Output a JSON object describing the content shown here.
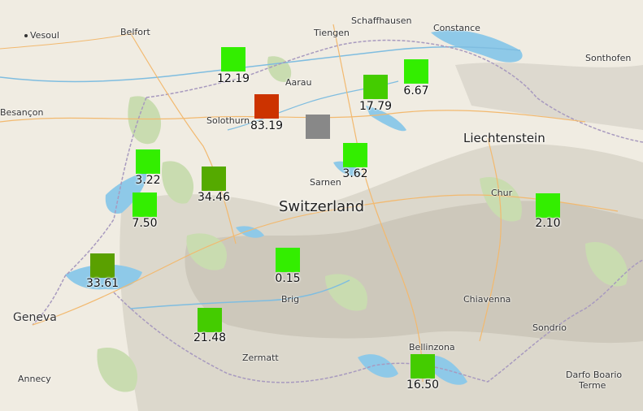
{
  "countries": {
    "switzerland": "Switzerland",
    "liechtenstein": "Liechtenstein"
  },
  "places": {
    "vesoul": "Vesoul",
    "belfort": "Belfort",
    "besancon": "Besançon",
    "tiengen": "Tiengen",
    "schaffhausen": "Schaffhausen",
    "constance": "Constance",
    "sonthofen": "Sonthofen",
    "aarau": "Aarau",
    "solothurn": "Solothurn",
    "sarnen": "Sarnen",
    "chur": "Chur",
    "geneva": "Geneva",
    "annecy": "Annecy",
    "brig": "Brig",
    "zermatt": "Zermatt",
    "chiavenna": "Chiavenna",
    "bellinzona": "Bellinzona",
    "sondrio": "Sondrio",
    "darfo_1": "Darfo Boario",
    "darfo_2": "Terme"
  },
  "colors": {
    "bright_green": "#33ee00",
    "green": "#44cc00",
    "dark_green": "#55aa00",
    "olive_green": "#5aa000",
    "red": "#cc3300",
    "gray": "#888888",
    "lake": "#8ec9e8",
    "water_blue": "#5aaee0"
  },
  "markers": [
    {
      "label": "12.19",
      "color": "#33ee00"
    },
    {
      "label": "83.19",
      "color": "#cc3300"
    },
    {
      "label": "",
      "color": "#888888"
    },
    {
      "label": "17.79",
      "color": "#44cc00"
    },
    {
      "label": "6.67",
      "color": "#33ee00"
    },
    {
      "label": "3.62",
      "color": "#33ee00"
    },
    {
      "label": "3.22",
      "color": "#33ee00"
    },
    {
      "label": "34.46",
      "color": "#55aa00"
    },
    {
      "label": "7.50",
      "color": "#33ee00"
    },
    {
      "label": "2.10",
      "color": "#33ee00"
    },
    {
      "label": "0.15",
      "color": "#33ee00"
    },
    {
      "label": "33.61",
      "color": "#5aa000"
    },
    {
      "label": "21.48",
      "color": "#44cc00"
    },
    {
      "label": "16.50",
      "color": "#44cc00"
    }
  ]
}
